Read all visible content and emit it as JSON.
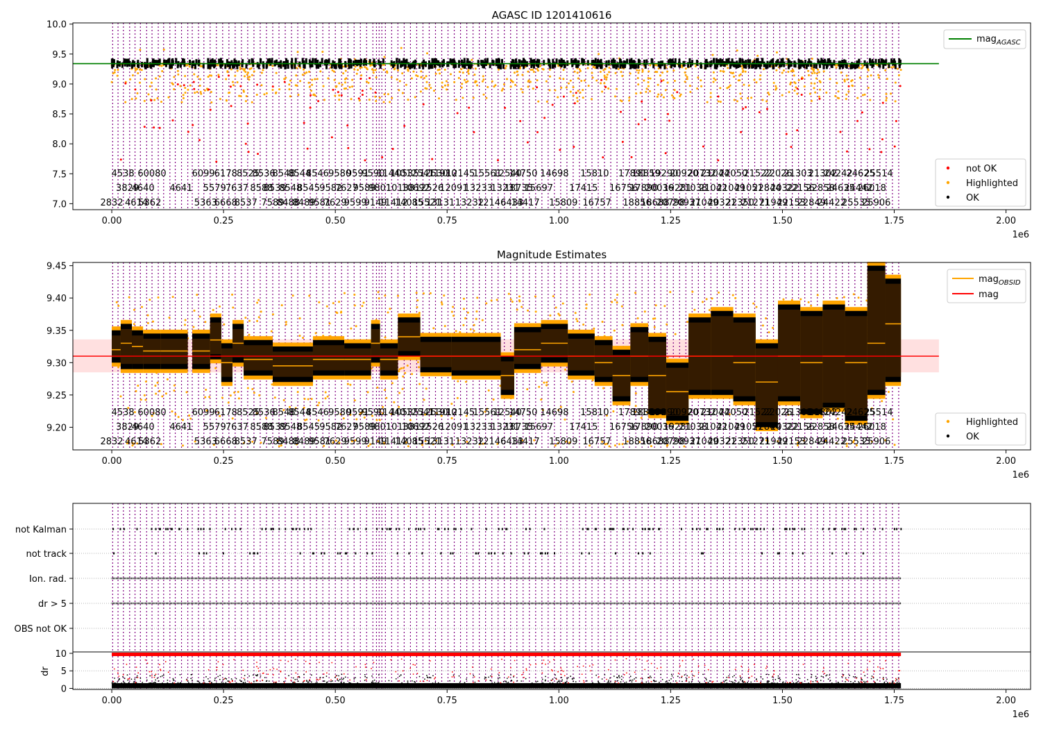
{
  "figure": {
    "exponent_label": "1e6",
    "x_ticks": [
      "0.00",
      "0.25",
      "0.50",
      "0.75",
      "1.00",
      "1.25",
      "1.50",
      "1.75",
      "2.00"
    ],
    "x_tick_values": [
      0,
      250000,
      500000,
      750000,
      1000000,
      1250000,
      1500000,
      1750000,
      2000000
    ],
    "xlim": [
      -87000,
      2055000
    ],
    "obsid_lines_x": [
      2000,
      14000,
      26000,
      40000,
      52000,
      64000,
      78000,
      90000,
      104000,
      116000,
      130000,
      142000,
      156000,
      170000,
      180000,
      194000,
      206000,
      220000,
      234000,
      248000,
      262000,
      276000,
      290000,
      304000,
      318000,
      332000,
      346000,
      360000,
      374000,
      388000,
      402000,
      416000,
      430000,
      444000,
      458000,
      472000,
      486000,
      500000,
      514000,
      528000,
      542000,
      556000,
      570000,
      584000,
      592000,
      598000,
      604000,
      612000,
      626000,
      640000,
      654000,
      668000,
      682000,
      696000,
      710000,
      724000,
      738000,
      752000,
      766000,
      780000,
      794000,
      808000,
      822000,
      836000,
      850000,
      864000,
      878000,
      892000,
      906000,
      920000,
      934000,
      948000,
      962000,
      976000,
      990000,
      1004000,
      1018000,
      1032000,
      1046000,
      1060000,
      1074000,
      1088000,
      1102000,
      1116000,
      1130000,
      1144000,
      1158000,
      1172000,
      1186000,
      1200000,
      1214000,
      1228000,
      1242000,
      1256000,
      1270000,
      1284000,
      1298000,
      1312000,
      1326000,
      1340000,
      1354000,
      1368000,
      1382000,
      1396000,
      1410000,
      1424000,
      1438000,
      1452000,
      1466000,
      1480000,
      1494000,
      1508000,
      1522000,
      1536000,
      1550000,
      1564000,
      1578000,
      1592000,
      1606000,
      1620000,
      1634000,
      1648000,
      1662000,
      1676000,
      1690000,
      1704000,
      1718000,
      1732000,
      1746000,
      1760000
    ],
    "obsid_labels": [
      {
        "x": 0,
        "row": 0,
        "text": "2832"
      },
      {
        "x": 25000,
        "row": 2,
        "text": "4538"
      },
      {
        "x": 35000,
        "row": 1,
        "text": "3829"
      },
      {
        "x": 55000,
        "row": 0,
        "text": "4614"
      },
      {
        "x": 70000,
        "row": 1,
        "text": "4640"
      },
      {
        "x": 85000,
        "row": 0,
        "text": "5362"
      },
      {
        "x": 90000,
        "row": 2,
        "text": "60080"
      },
      {
        "x": 155000,
        "row": 1,
        "text": "4641"
      },
      {
        "x": 205000,
        "row": 2,
        "text": "6099"
      },
      {
        "x": 210000,
        "row": 0,
        "text": "5363"
      },
      {
        "x": 230000,
        "row": 1,
        "text": "5579"
      },
      {
        "x": 255000,
        "row": 0,
        "text": "6668"
      },
      {
        "x": 255000,
        "row": 2,
        "text": "6178"
      },
      {
        "x": 280000,
        "row": 1,
        "text": "7637"
      },
      {
        "x": 300000,
        "row": 0,
        "text": "8537"
      },
      {
        "x": 305000,
        "row": 2,
        "text": "8525"
      },
      {
        "x": 335000,
        "row": 1,
        "text": "8588"
      },
      {
        "x": 340000,
        "row": 2,
        "text": "8536"
      },
      {
        "x": 360000,
        "row": 0,
        "text": "7589"
      },
      {
        "x": 365000,
        "row": 1,
        "text": "8539"
      },
      {
        "x": 385000,
        "row": 2,
        "text": "8548"
      },
      {
        "x": 395000,
        "row": 0,
        "text": "8488"
      },
      {
        "x": 400000,
        "row": 1,
        "text": "8548"
      },
      {
        "x": 420000,
        "row": 2,
        "text": "8544"
      },
      {
        "x": 430000,
        "row": 0,
        "text": "8489"
      },
      {
        "x": 440000,
        "row": 1,
        "text": "8545"
      },
      {
        "x": 460000,
        "row": 2,
        "text": "8546"
      },
      {
        "x": 465000,
        "row": 0,
        "text": "9581"
      },
      {
        "x": 490000,
        "row": 1,
        "text": "9582"
      },
      {
        "x": 500000,
        "row": 0,
        "text": "7629"
      },
      {
        "x": 510000,
        "row": 2,
        "text": "9580"
      },
      {
        "x": 525000,
        "row": 1,
        "text": "7627"
      },
      {
        "x": 545000,
        "row": 0,
        "text": "9599"
      },
      {
        "x": 550000,
        "row": 2,
        "text": "9591"
      },
      {
        "x": 565000,
        "row": 1,
        "text": "9589"
      },
      {
        "x": 585000,
        "row": 2,
        "text": "9590"
      },
      {
        "x": 590000,
        "row": 0,
        "text": "9149"
      },
      {
        "x": 600000,
        "row": 1,
        "text": "9801"
      },
      {
        "x": 625000,
        "row": 2,
        "text": "11440"
      },
      {
        "x": 630000,
        "row": 0,
        "text": "11412"
      },
      {
        "x": 645000,
        "row": 1,
        "text": "10138"
      },
      {
        "x": 655000,
        "row": 2,
        "text": "10535"
      },
      {
        "x": 665000,
        "row": 0,
        "text": "14085"
      },
      {
        "x": 680000,
        "row": 1,
        "text": "10692"
      },
      {
        "x": 690000,
        "row": 2,
        "text": "12541"
      },
      {
        "x": 705000,
        "row": 0,
        "text": "15521"
      },
      {
        "x": 710000,
        "row": 1,
        "text": "12526"
      },
      {
        "x": 720000,
        "row": 2,
        "text": "12530"
      },
      {
        "x": 735000,
        "row": 0,
        "text": "13131"
      },
      {
        "x": 740000,
        "row": 2,
        "text": "11910"
      },
      {
        "x": 765000,
        "row": 1,
        "text": "12091"
      },
      {
        "x": 780000,
        "row": 2,
        "text": "12145"
      },
      {
        "x": 800000,
        "row": 0,
        "text": "13232"
      },
      {
        "x": 820000,
        "row": 1,
        "text": "13233"
      },
      {
        "x": 840000,
        "row": 2,
        "text": "15561"
      },
      {
        "x": 850000,
        "row": 0,
        "text": "12146"
      },
      {
        "x": 880000,
        "row": 1,
        "text": "13231"
      },
      {
        "x": 885000,
        "row": 2,
        "text": "12540"
      },
      {
        "x": 895000,
        "row": 0,
        "text": "6433"
      },
      {
        "x": 910000,
        "row": 1,
        "text": "18735"
      },
      {
        "x": 920000,
        "row": 2,
        "text": "14750"
      },
      {
        "x": 925000,
        "row": 0,
        "text": "14417"
      },
      {
        "x": 955000,
        "row": 1,
        "text": "15697"
      },
      {
        "x": 990000,
        "row": 2,
        "text": "14698"
      },
      {
        "x": 1010000,
        "row": 0,
        "text": "15809"
      },
      {
        "x": 1055000,
        "row": 1,
        "text": "17415"
      },
      {
        "x": 1080000,
        "row": 2,
        "text": "15810"
      },
      {
        "x": 1085000,
        "row": 0,
        "text": "16757"
      },
      {
        "x": 1145000,
        "row": 1,
        "text": "16756"
      },
      {
        "x": 1165000,
        "row": 2,
        "text": "17891"
      },
      {
        "x": 1175000,
        "row": 0,
        "text": "18856"
      },
      {
        "x": 1190000,
        "row": 1,
        "text": "17890"
      },
      {
        "x": 1195000,
        "row": 2,
        "text": "18859"
      },
      {
        "x": 1215000,
        "row": 0,
        "text": "18688"
      },
      {
        "x": 1225000,
        "row": 1,
        "text": "20036"
      },
      {
        "x": 1235000,
        "row": 2,
        "text": "19290"
      },
      {
        "x": 1250000,
        "row": 0,
        "text": "20798"
      },
      {
        "x": 1265000,
        "row": 1,
        "text": "19281"
      },
      {
        "x": 1280000,
        "row": 2,
        "text": "20920"
      },
      {
        "x": 1285000,
        "row": 0,
        "text": "20937"
      },
      {
        "x": 1300000,
        "row": 1,
        "text": "21038"
      },
      {
        "x": 1320000,
        "row": 2,
        "text": "20732"
      },
      {
        "x": 1325000,
        "row": 0,
        "text": "21049"
      },
      {
        "x": 1345000,
        "row": 1,
        "text": "21042"
      },
      {
        "x": 1350000,
        "row": 2,
        "text": "21044"
      },
      {
        "x": 1365000,
        "row": 0,
        "text": "20321"
      },
      {
        "x": 1385000,
        "row": 1,
        "text": "21049"
      },
      {
        "x": 1390000,
        "row": 2,
        "text": "22050"
      },
      {
        "x": 1405000,
        "row": 0,
        "text": "22350"
      },
      {
        "x": 1425000,
        "row": 1,
        "text": "21051"
      },
      {
        "x": 1440000,
        "row": 0,
        "text": "21271"
      },
      {
        "x": 1445000,
        "row": 2,
        "text": "21522"
      },
      {
        "x": 1465000,
        "row": 1,
        "text": "22844"
      },
      {
        "x": 1480000,
        "row": 0,
        "text": "21949"
      },
      {
        "x": 1490000,
        "row": 2,
        "text": "22026"
      },
      {
        "x": 1505000,
        "row": 1,
        "text": "20322"
      },
      {
        "x": 1520000,
        "row": 0,
        "text": "22153"
      },
      {
        "x": 1535000,
        "row": 2,
        "text": "21303"
      },
      {
        "x": 1540000,
        "row": 1,
        "text": "22156"
      },
      {
        "x": 1565000,
        "row": 0,
        "text": "22849"
      },
      {
        "x": 1585000,
        "row": 1,
        "text": "22858"
      },
      {
        "x": 1590000,
        "row": 2,
        "text": "21302"
      },
      {
        "x": 1610000,
        "row": 0,
        "text": "24422"
      },
      {
        "x": 1625000,
        "row": 2,
        "text": "24242"
      },
      {
        "x": 1630000,
        "row": 1,
        "text": "24635"
      },
      {
        "x": 1665000,
        "row": 0,
        "text": "25535"
      },
      {
        "x": 1670000,
        "row": 1,
        "text": "24442"
      },
      {
        "x": 1675000,
        "row": 2,
        "text": "24625"
      },
      {
        "x": 1700000,
        "row": 1,
        "text": "26018"
      },
      {
        "x": 1710000,
        "row": 0,
        "text": "25906"
      },
      {
        "x": 1715000,
        "row": 2,
        "text": "25514"
      }
    ],
    "x_end": 1765000
  },
  "chart_data": [
    {
      "type": "scatter",
      "title": "AGASC ID 1201410616",
      "ylim": [
        6.9,
        10.02
      ],
      "y_ticks": [
        "7.0",
        "7.5",
        "8.0",
        "8.5",
        "9.0",
        "9.5",
        "10.0"
      ],
      "y_tick_values": [
        7.0,
        7.5,
        8.0,
        8.5,
        9.0,
        9.5,
        10.0
      ],
      "mag_aca_line": {
        "y": 9.34,
        "x_range": [
          -87000,
          1850000
        ],
        "color": "#008000"
      },
      "legend_lines": [
        {
          "label": "mag",
          "subscript": "AGASC",
          "color": "#008000"
        }
      ],
      "legend_markers": [
        {
          "label": "not OK",
          "color": "#ff0000"
        },
        {
          "label": "Highlighted",
          "color": "#ffa500"
        },
        {
          "label": "OK",
          "color": "#000000"
        }
      ],
      "band": {
        "center": 9.33,
        "halfwidth": 0.03
      },
      "scatter_orange_range": [
        8.7,
        9.65
      ],
      "scatter_red_range": [
        7.6,
        9.1
      ],
      "legend_placement": "upper right / lower right"
    },
    {
      "type": "scatter",
      "title": "Magnitude Estimates",
      "ylim": [
        9.165,
        9.455
      ],
      "y_ticks": [
        "9.20",
        "9.25",
        "9.30",
        "9.35",
        "9.40",
        "9.45"
      ],
      "y_tick_values": [
        9.2,
        9.25,
        9.3,
        9.35,
        9.4,
        9.45
      ],
      "mag_line": {
        "y": 9.31,
        "color": "#ff0000",
        "band": [
          9.285,
          9.336
        ]
      },
      "legend_lines": [
        {
          "label": "mag",
          "subscript": "OBSID",
          "color": "#ffa500"
        },
        {
          "label": "mag",
          "subscript": "",
          "color": "#ff0000"
        }
      ],
      "legend_markers": [
        {
          "label": "Highlighted",
          "color": "#ffa500"
        },
        {
          "label": "OK",
          "color": "#000000"
        }
      ],
      "segments": [
        {
          "x0": 0,
          "x1": 20000,
          "lo": 9.3,
          "hi": 9.35,
          "mean": 9.32
        },
        {
          "x0": 20000,
          "x1": 45000,
          "lo": 9.29,
          "hi": 9.36,
          "mean": 9.33
        },
        {
          "x0": 45000,
          "x1": 70000,
          "lo": 9.29,
          "hi": 9.35,
          "mean": 9.325
        },
        {
          "x0": 70000,
          "x1": 110000,
          "lo": 9.29,
          "hi": 9.345,
          "mean": 9.318
        },
        {
          "x0": 110000,
          "x1": 170000,
          "lo": 9.29,
          "hi": 9.345,
          "mean": 9.318
        },
        {
          "x0": 180000,
          "x1": 220000,
          "lo": 9.29,
          "hi": 9.345,
          "mean": 9.318
        },
        {
          "x0": 220000,
          "x1": 245000,
          "lo": 9.305,
          "hi": 9.37,
          "mean": 9.335
        },
        {
          "x0": 245000,
          "x1": 270000,
          "lo": 9.27,
          "hi": 9.33,
          "mean": 9.3
        },
        {
          "x0": 270000,
          "x1": 295000,
          "lo": 9.3,
          "hi": 9.36,
          "mean": 9.33
        },
        {
          "x0": 295000,
          "x1": 360000,
          "lo": 9.28,
          "hi": 9.335,
          "mean": 9.305
        },
        {
          "x0": 360000,
          "x1": 450000,
          "lo": 9.27,
          "hi": 9.325,
          "mean": 9.295
        },
        {
          "x0": 450000,
          "x1": 520000,
          "lo": 9.28,
          "hi": 9.335,
          "mean": 9.305
        },
        {
          "x0": 520000,
          "x1": 580000,
          "lo": 9.28,
          "hi": 9.33,
          "mean": 9.305
        },
        {
          "x0": 580000,
          "x1": 600000,
          "lo": 9.3,
          "hi": 9.36,
          "mean": 9.33
        },
        {
          "x0": 600000,
          "x1": 640000,
          "lo": 9.28,
          "hi": 9.33,
          "mean": 9.305
        },
        {
          "x0": 640000,
          "x1": 690000,
          "lo": 9.31,
          "hi": 9.37,
          "mean": 9.34
        },
        {
          "x0": 690000,
          "x1": 760000,
          "lo": 9.285,
          "hi": 9.34,
          "mean": 9.31
        },
        {
          "x0": 760000,
          "x1": 870000,
          "lo": 9.28,
          "hi": 9.34,
          "mean": 9.31
        },
        {
          "x0": 870000,
          "x1": 900000,
          "lo": 9.25,
          "hi": 9.31,
          "mean": 9.28
        },
        {
          "x0": 900000,
          "x1": 960000,
          "lo": 9.29,
          "hi": 9.355,
          "mean": 9.32
        },
        {
          "x0": 960000,
          "x1": 1020000,
          "lo": 9.3,
          "hi": 9.36,
          "mean": 9.33
        },
        {
          "x0": 1020000,
          "x1": 1080000,
          "lo": 9.28,
          "hi": 9.345,
          "mean": 9.31
        },
        {
          "x0": 1080000,
          "x1": 1120000,
          "lo": 9.27,
          "hi": 9.335,
          "mean": 9.3
        },
        {
          "x0": 1120000,
          "x1": 1160000,
          "lo": 9.24,
          "hi": 9.32,
          "mean": 9.28
        },
        {
          "x0": 1160000,
          "x1": 1200000,
          "lo": 9.27,
          "hi": 9.355,
          "mean": 9.31
        },
        {
          "x0": 1200000,
          "x1": 1240000,
          "lo": 9.22,
          "hi": 9.34,
          "mean": 9.28
        },
        {
          "x0": 1240000,
          "x1": 1290000,
          "lo": 9.21,
          "hi": 9.3,
          "mean": 9.255
        },
        {
          "x0": 1290000,
          "x1": 1340000,
          "lo": 9.25,
          "hi": 9.37,
          "mean": 9.31
        },
        {
          "x0": 1340000,
          "x1": 1390000,
          "lo": 9.25,
          "hi": 9.38,
          "mean": 9.31
        },
        {
          "x0": 1390000,
          "x1": 1440000,
          "lo": 9.24,
          "hi": 9.37,
          "mean": 9.3
        },
        {
          "x0": 1440000,
          "x1": 1490000,
          "lo": 9.2,
          "hi": 9.33,
          "mean": 9.27
        },
        {
          "x0": 1490000,
          "x1": 1540000,
          "lo": 9.24,
          "hi": 9.39,
          "mean": 9.31
        },
        {
          "x0": 1540000,
          "x1": 1590000,
          "lo": 9.22,
          "hi": 9.38,
          "mean": 9.3
        },
        {
          "x0": 1590000,
          "x1": 1640000,
          "lo": 9.23,
          "hi": 9.39,
          "mean": 9.31
        },
        {
          "x0": 1640000,
          "x1": 1690000,
          "lo": 9.21,
          "hi": 9.38,
          "mean": 9.3
        },
        {
          "x0": 1690000,
          "x1": 1730000,
          "lo": 9.25,
          "hi": 9.45,
          "mean": 9.33
        },
        {
          "x0": 1730000,
          "x1": 1765000,
          "lo": 9.27,
          "hi": 9.43,
          "mean": 9.36
        }
      ]
    },
    {
      "type": "scatter",
      "categories": [
        "OBS not OK",
        "dr > 5",
        "Ion. rad.",
        "not track",
        "not Kalman"
      ],
      "flag_rows": [
        {
          "label": "not Kalman",
          "density": 0.35
        },
        {
          "label": "not track",
          "density": 0.15
        },
        {
          "label": "Ion. rad.",
          "density": 1.0
        },
        {
          "label": "dr > 5",
          "density": 1.0
        },
        {
          "label": "OBS not OK",
          "density": 0.0
        }
      ],
      "dr_axis": {
        "ylabel": "dr",
        "y_ticks": [
          "0",
          "5",
          "10"
        ],
        "y_tick_values": [
          0,
          5,
          10
        ],
        "ylim": [
          -0.3,
          10.2
        ],
        "threshold": 10
      }
    }
  ]
}
